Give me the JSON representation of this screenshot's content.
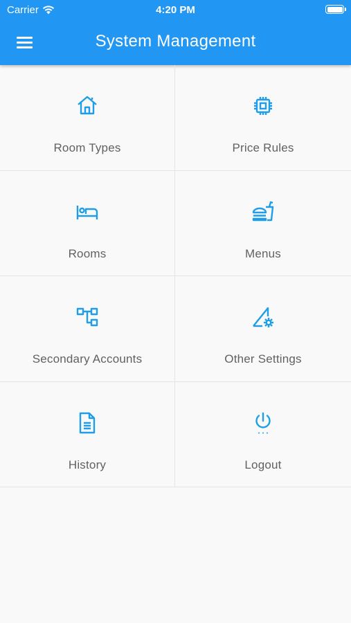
{
  "status_bar": {
    "carrier": "Carrier",
    "time": "4:20 PM"
  },
  "header": {
    "title": "System Management",
    "menu_icon": "hamburger-menu-icon"
  },
  "accent_color": "#2196f3",
  "icon_color": "#1e9ee8",
  "tiles": [
    {
      "label": "Room Types",
      "icon": "house-icon"
    },
    {
      "label": "Price Rules",
      "icon": "chip-icon"
    },
    {
      "label": "Rooms",
      "icon": "bed-icon"
    },
    {
      "label": "Menus",
      "icon": "fastfood-icon"
    },
    {
      "label": "Secondary Accounts",
      "icon": "account-tree-icon"
    },
    {
      "label": "Other Settings",
      "icon": "settings-ruler-icon"
    },
    {
      "label": "History",
      "icon": "document-icon"
    },
    {
      "label": "Logout",
      "icon": "power-icon"
    }
  ]
}
